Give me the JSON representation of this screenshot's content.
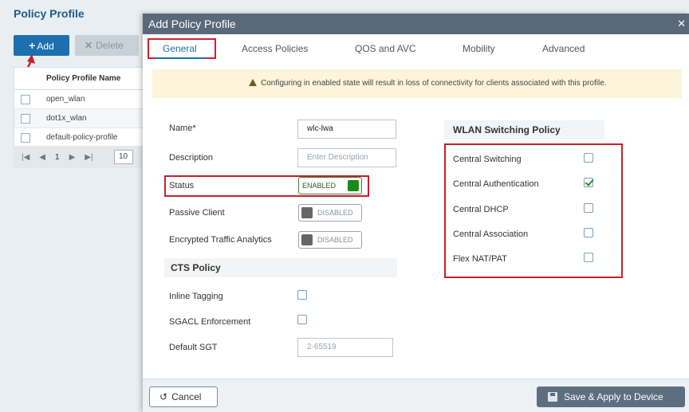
{
  "background": {
    "page_title": "Policy Profile",
    "add_label": "Add",
    "delete_label": "Delete",
    "column_header": "Policy Profile Name",
    "rows": [
      "open_wlan",
      "dot1x_wlan",
      "default-policy-profile"
    ],
    "pager": {
      "current_page": "1",
      "page_size": "10"
    }
  },
  "modal": {
    "title": "Add Policy Profile",
    "tabs": [
      "General",
      "Access Policies",
      "QOS and AVC",
      "Mobility",
      "Advanced"
    ],
    "active_tab": "General",
    "warning": "Configuring in enabled state will result in loss of connectivity for clients associated with this profile.",
    "general": {
      "name_label": "Name*",
      "name_value": "wlc-lwa",
      "description_label": "Description",
      "description_placeholder": "Enter Description",
      "status_label": "Status",
      "status_value": "ENABLED",
      "passive_client_label": "Passive Client",
      "passive_client_value": "DISABLED",
      "eta_label": "Encrypted Traffic Analytics",
      "eta_value": "DISABLED"
    },
    "cts": {
      "title": "CTS Policy",
      "inline_tagging_label": "Inline Tagging",
      "inline_tagging_checked": false,
      "sgacl_label": "SGACL Enforcement",
      "sgacl_checked": false,
      "default_sgt_label": "Default SGT",
      "default_sgt_placeholder": "2-65519"
    },
    "wlan_switching": {
      "title": "WLAN Switching Policy",
      "items": [
        {
          "label": "Central Switching",
          "checked": false
        },
        {
          "label": "Central Authentication",
          "checked": true
        },
        {
          "label": "Central DHCP",
          "checked": false
        },
        {
          "label": "Central Association",
          "checked": false
        },
        {
          "label": "Flex NAT/PAT",
          "checked": false
        }
      ]
    },
    "footer": {
      "cancel_label": "Cancel",
      "apply_label": "Save & Apply to Device"
    }
  },
  "colors": {
    "header_bg": "#59697a",
    "accent_blue": "#1e6fb0",
    "highlight_red": "#c7202a",
    "enabled_green": "#1a8a1a",
    "warning_bg": "#fcf5dc"
  }
}
